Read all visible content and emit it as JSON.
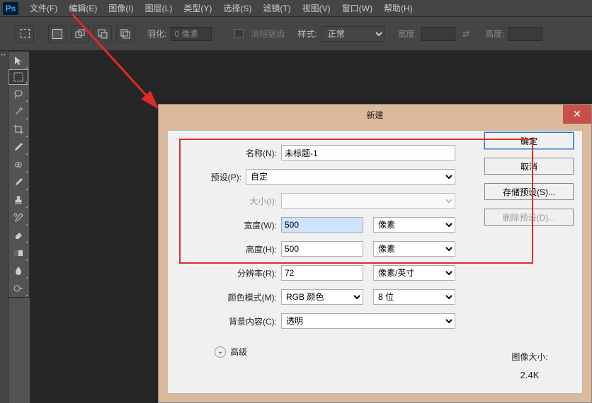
{
  "app": {
    "logo": "Ps"
  },
  "menu": {
    "file": "文件(F)",
    "edit": "编辑(E)",
    "image": "图像(I)",
    "layer": "图层(L)",
    "type": "类型(Y)",
    "select": "选择(S)",
    "filter": "滤镜(T)",
    "view": "视图(V)",
    "window": "窗口(W)",
    "help": "帮助(H)"
  },
  "options": {
    "feather_label": "羽化:",
    "feather_value": "0 像素",
    "antialias": "消除锯齿",
    "style_label": "样式:",
    "style_value": "正常",
    "width_label": "宽度:",
    "height_label": "高度:"
  },
  "dialog": {
    "title": "新建",
    "name_label": "名称(N):",
    "name_value": "未标题-1",
    "preset_label": "预设(P):",
    "preset_value": "自定",
    "size_label": "大小(I):",
    "width_label": "宽度(W):",
    "width_value": "500",
    "width_unit": "像素",
    "height_label": "高度(H):",
    "height_value": "500",
    "height_unit": "像素",
    "res_label": "分辨率(R):",
    "res_value": "72",
    "res_unit": "像素/英寸",
    "mode_label": "颜色模式(M):",
    "mode_value": "RGB 颜色",
    "mode_depth": "8 位",
    "bg_label": "背景内容(C):",
    "bg_value": "透明",
    "advanced": "高级",
    "ok": "确定",
    "cancel": "取消",
    "save_preset": "存储预设(S)...",
    "delete_preset": "删除预设(D)...",
    "imgsize_label": "图像大小:",
    "imgsize_value": "2.4K"
  }
}
